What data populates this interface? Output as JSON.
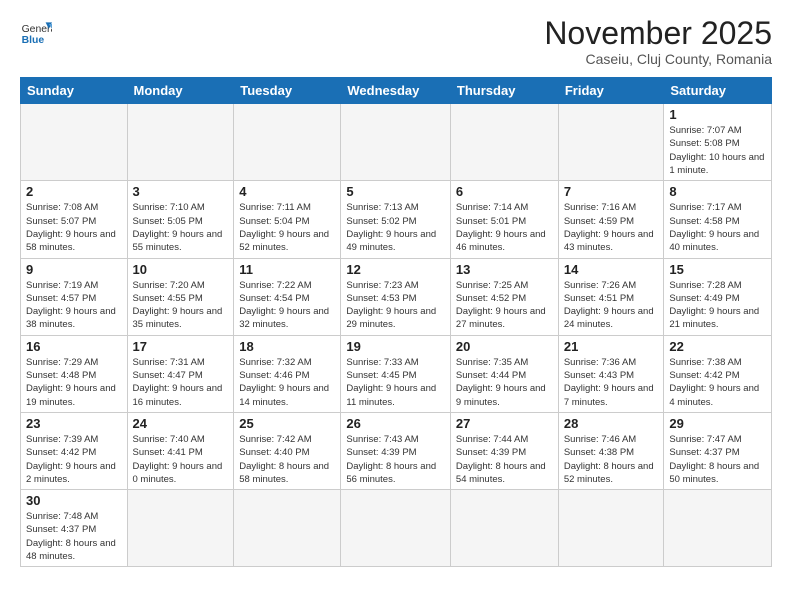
{
  "header": {
    "logo_general": "General",
    "logo_blue": "Blue",
    "month_title": "November 2025",
    "location": "Caseiu, Cluj County, Romania"
  },
  "weekdays": [
    "Sunday",
    "Monday",
    "Tuesday",
    "Wednesday",
    "Thursday",
    "Friday",
    "Saturday"
  ],
  "weeks": [
    [
      {
        "day": "",
        "info": ""
      },
      {
        "day": "",
        "info": ""
      },
      {
        "day": "",
        "info": ""
      },
      {
        "day": "",
        "info": ""
      },
      {
        "day": "",
        "info": ""
      },
      {
        "day": "",
        "info": ""
      },
      {
        "day": "1",
        "info": "Sunrise: 7:07 AM\nSunset: 5:08 PM\nDaylight: 10 hours\nand 1 minute."
      }
    ],
    [
      {
        "day": "2",
        "info": "Sunrise: 7:08 AM\nSunset: 5:07 PM\nDaylight: 9 hours\nand 58 minutes."
      },
      {
        "day": "3",
        "info": "Sunrise: 7:10 AM\nSunset: 5:05 PM\nDaylight: 9 hours\nand 55 minutes."
      },
      {
        "day": "4",
        "info": "Sunrise: 7:11 AM\nSunset: 5:04 PM\nDaylight: 9 hours\nand 52 minutes."
      },
      {
        "day": "5",
        "info": "Sunrise: 7:13 AM\nSunset: 5:02 PM\nDaylight: 9 hours\nand 49 minutes."
      },
      {
        "day": "6",
        "info": "Sunrise: 7:14 AM\nSunset: 5:01 PM\nDaylight: 9 hours\nand 46 minutes."
      },
      {
        "day": "7",
        "info": "Sunrise: 7:16 AM\nSunset: 4:59 PM\nDaylight: 9 hours\nand 43 minutes."
      },
      {
        "day": "8",
        "info": "Sunrise: 7:17 AM\nSunset: 4:58 PM\nDaylight: 9 hours\nand 40 minutes."
      }
    ],
    [
      {
        "day": "9",
        "info": "Sunrise: 7:19 AM\nSunset: 4:57 PM\nDaylight: 9 hours\nand 38 minutes."
      },
      {
        "day": "10",
        "info": "Sunrise: 7:20 AM\nSunset: 4:55 PM\nDaylight: 9 hours\nand 35 minutes."
      },
      {
        "day": "11",
        "info": "Sunrise: 7:22 AM\nSunset: 4:54 PM\nDaylight: 9 hours\nand 32 minutes."
      },
      {
        "day": "12",
        "info": "Sunrise: 7:23 AM\nSunset: 4:53 PM\nDaylight: 9 hours\nand 29 minutes."
      },
      {
        "day": "13",
        "info": "Sunrise: 7:25 AM\nSunset: 4:52 PM\nDaylight: 9 hours\nand 27 minutes."
      },
      {
        "day": "14",
        "info": "Sunrise: 7:26 AM\nSunset: 4:51 PM\nDaylight: 9 hours\nand 24 minutes."
      },
      {
        "day": "15",
        "info": "Sunrise: 7:28 AM\nSunset: 4:49 PM\nDaylight: 9 hours\nand 21 minutes."
      }
    ],
    [
      {
        "day": "16",
        "info": "Sunrise: 7:29 AM\nSunset: 4:48 PM\nDaylight: 9 hours\nand 19 minutes."
      },
      {
        "day": "17",
        "info": "Sunrise: 7:31 AM\nSunset: 4:47 PM\nDaylight: 9 hours\nand 16 minutes."
      },
      {
        "day": "18",
        "info": "Sunrise: 7:32 AM\nSunset: 4:46 PM\nDaylight: 9 hours\nand 14 minutes."
      },
      {
        "day": "19",
        "info": "Sunrise: 7:33 AM\nSunset: 4:45 PM\nDaylight: 9 hours\nand 11 minutes."
      },
      {
        "day": "20",
        "info": "Sunrise: 7:35 AM\nSunset: 4:44 PM\nDaylight: 9 hours\nand 9 minutes."
      },
      {
        "day": "21",
        "info": "Sunrise: 7:36 AM\nSunset: 4:43 PM\nDaylight: 9 hours\nand 7 minutes."
      },
      {
        "day": "22",
        "info": "Sunrise: 7:38 AM\nSunset: 4:42 PM\nDaylight: 9 hours\nand 4 minutes."
      }
    ],
    [
      {
        "day": "23",
        "info": "Sunrise: 7:39 AM\nSunset: 4:42 PM\nDaylight: 9 hours\nand 2 minutes."
      },
      {
        "day": "24",
        "info": "Sunrise: 7:40 AM\nSunset: 4:41 PM\nDaylight: 9 hours\nand 0 minutes."
      },
      {
        "day": "25",
        "info": "Sunrise: 7:42 AM\nSunset: 4:40 PM\nDaylight: 8 hours\nand 58 minutes."
      },
      {
        "day": "26",
        "info": "Sunrise: 7:43 AM\nSunset: 4:39 PM\nDaylight: 8 hours\nand 56 minutes."
      },
      {
        "day": "27",
        "info": "Sunrise: 7:44 AM\nSunset: 4:39 PM\nDaylight: 8 hours\nand 54 minutes."
      },
      {
        "day": "28",
        "info": "Sunrise: 7:46 AM\nSunset: 4:38 PM\nDaylight: 8 hours\nand 52 minutes."
      },
      {
        "day": "29",
        "info": "Sunrise: 7:47 AM\nSunset: 4:37 PM\nDaylight: 8 hours\nand 50 minutes."
      }
    ],
    [
      {
        "day": "30",
        "info": "Sunrise: 7:48 AM\nSunset: 4:37 PM\nDaylight: 8 hours\nand 48 minutes."
      },
      {
        "day": "",
        "info": ""
      },
      {
        "day": "",
        "info": ""
      },
      {
        "day": "",
        "info": ""
      },
      {
        "day": "",
        "info": ""
      },
      {
        "day": "",
        "info": ""
      },
      {
        "day": "",
        "info": ""
      }
    ]
  ]
}
